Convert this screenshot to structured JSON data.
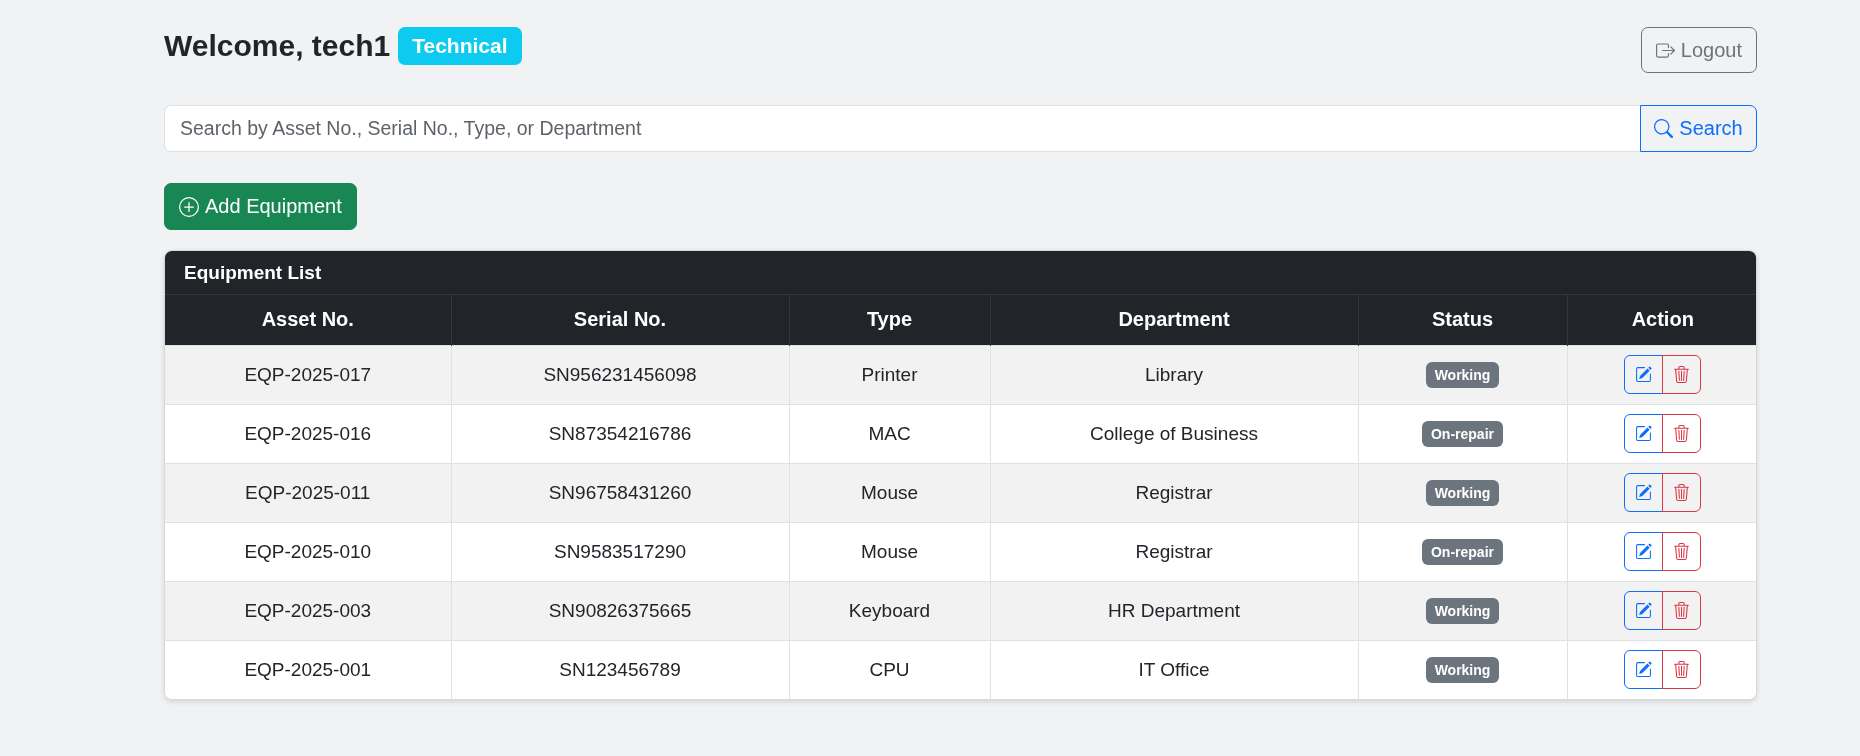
{
  "header": {
    "title": "Welcome, tech1",
    "role_badge": "Technical",
    "logout_button": "Logout"
  },
  "search": {
    "placeholder": "Search by Asset No., Serial No., Type, or Department",
    "button": "Search"
  },
  "add_button": "Add Equipment",
  "table": {
    "title": "Equipment List",
    "columns": [
      "Asset No.",
      "Serial No.",
      "Type",
      "Department",
      "Status",
      "Action"
    ],
    "rows": [
      {
        "asset_no": "EQP-2025-017",
        "serial_no": "SN956231456098",
        "type": "Printer",
        "department": "Library",
        "status": "Working"
      },
      {
        "asset_no": "EQP-2025-016",
        "serial_no": "SN87354216786",
        "type": "MAC",
        "department": "College of Business",
        "status": "On-repair"
      },
      {
        "asset_no": "EQP-2025-011",
        "serial_no": "SN96758431260",
        "type": "Mouse",
        "department": "Registrar",
        "status": "Working"
      },
      {
        "asset_no": "EQP-2025-010",
        "serial_no": "SN9583517290",
        "type": "Mouse",
        "department": "Registrar",
        "status": "On-repair"
      },
      {
        "asset_no": "EQP-2025-003",
        "serial_no": "SN90826375665",
        "type": "Keyboard",
        "department": "HR Department",
        "status": "Working"
      },
      {
        "asset_no": "EQP-2025-001",
        "serial_no": "SN123456789",
        "type": "CPU",
        "department": "IT Office",
        "status": "Working"
      }
    ]
  }
}
